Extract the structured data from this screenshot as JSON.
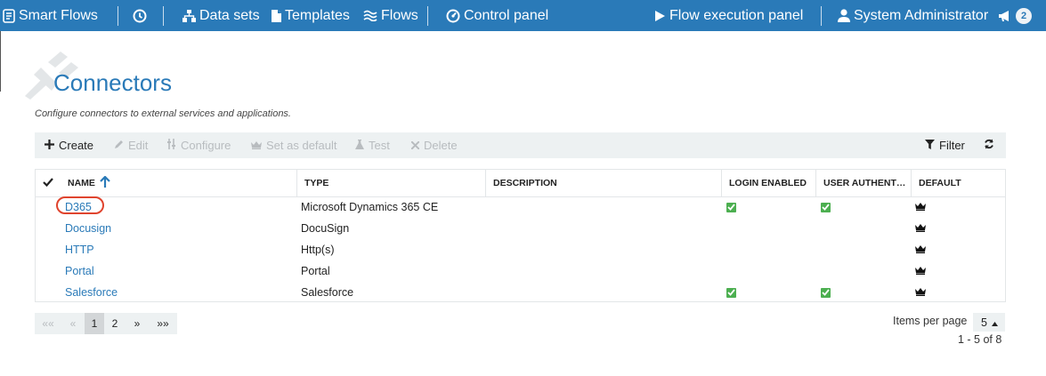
{
  "nav": {
    "brand": "Smart Flows",
    "data_sets": "Data sets",
    "templates": "Templates",
    "flows": "Flows",
    "control_panel": "Control panel",
    "flow_execution": "Flow execution panel",
    "user": "System Administrator",
    "notification_count": "2"
  },
  "header": {
    "title": "Connectors",
    "subtitle": "Configure connectors to external services and applications."
  },
  "toolbar": {
    "create": "Create",
    "edit": "Edit",
    "configure": "Configure",
    "set_default": "Set as default",
    "test": "Test",
    "delete": "Delete",
    "filter": "Filter"
  },
  "table": {
    "columns": {
      "name": "NAME",
      "type": "TYPE",
      "description": "DESCRIPTION",
      "login_enabled": "LOGIN ENABLED",
      "user_auth": "USER AUTHENT…",
      "default": "DEFAULT"
    },
    "rows": [
      {
        "name": "D365",
        "type": "Microsoft Dynamics 365 CE",
        "description": "",
        "login_enabled": true,
        "user_auth": true,
        "default": true
      },
      {
        "name": "Docusign",
        "type": "DocuSign",
        "description": "",
        "login_enabled": false,
        "user_auth": false,
        "default": true
      },
      {
        "name": "HTTP",
        "type": "Http(s)",
        "description": "",
        "login_enabled": false,
        "user_auth": false,
        "default": true
      },
      {
        "name": "Portal",
        "type": "Portal",
        "description": "",
        "login_enabled": false,
        "user_auth": false,
        "default": true
      },
      {
        "name": "Salesforce",
        "type": "Salesforce",
        "description": "",
        "login_enabled": true,
        "user_auth": true,
        "default": true
      }
    ]
  },
  "pager": {
    "first": "««",
    "prev": "«",
    "pages": [
      "1",
      "2"
    ],
    "current": "1",
    "next": "»",
    "last": "»»",
    "items_per_page_label": "Items per page",
    "items_per_page": "5",
    "range": "1 - 5 of 8"
  },
  "colors": {
    "primary": "#2a7ab8",
    "check": "#4caf50",
    "highlight": "#e0442e"
  }
}
